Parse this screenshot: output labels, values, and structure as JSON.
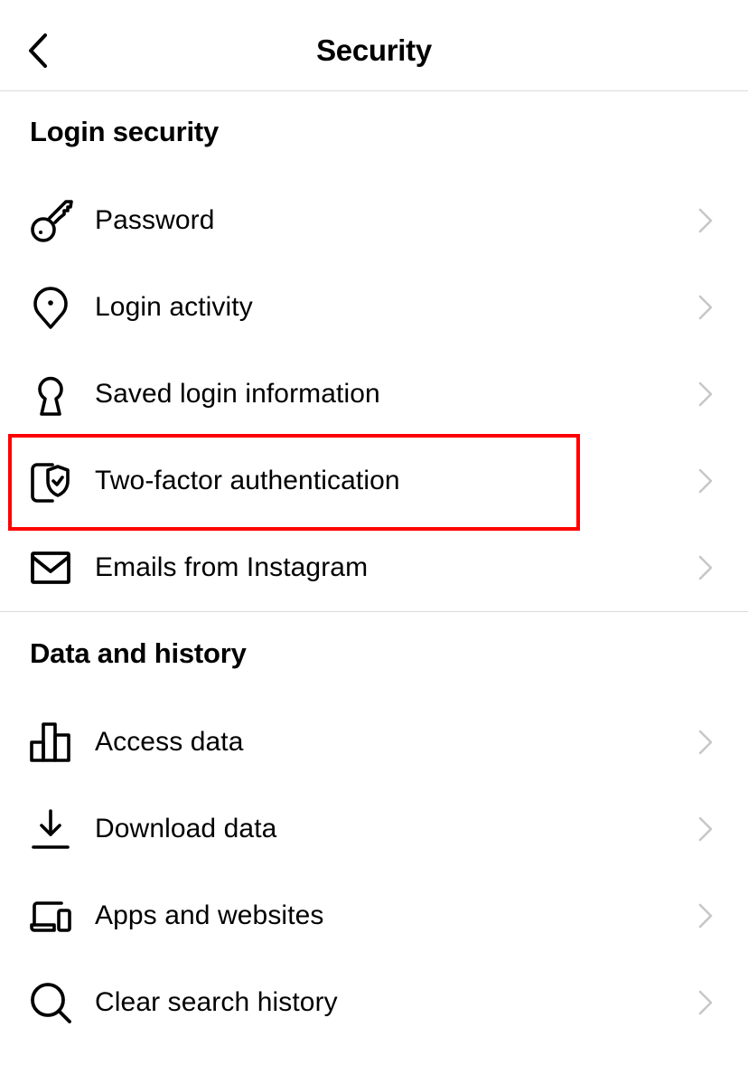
{
  "header": {
    "title": "Security",
    "back_icon": "chevron-left-icon"
  },
  "sections": [
    {
      "title": "Login security",
      "items": [
        {
          "label": "Password",
          "icon": "key-icon"
        },
        {
          "label": "Login activity",
          "icon": "location-pin-icon"
        },
        {
          "label": "Saved login information",
          "icon": "keyhole-icon"
        },
        {
          "label": "Two-factor authentication",
          "icon": "phone-shield-icon",
          "highlighted": true
        },
        {
          "label": "Emails from Instagram",
          "icon": "envelope-icon"
        }
      ]
    },
    {
      "title": "Data and history",
      "items": [
        {
          "label": "Access data",
          "icon": "bar-chart-icon"
        },
        {
          "label": "Download data",
          "icon": "download-icon"
        },
        {
          "label": "Apps and websites",
          "icon": "devices-icon"
        },
        {
          "label": "Clear search history",
          "icon": "search-icon"
        }
      ]
    }
  ],
  "colors": {
    "highlight": "#ff0000",
    "divider": "#dbdbdb",
    "chevron": "#c7c7c7",
    "text": "#000000"
  }
}
